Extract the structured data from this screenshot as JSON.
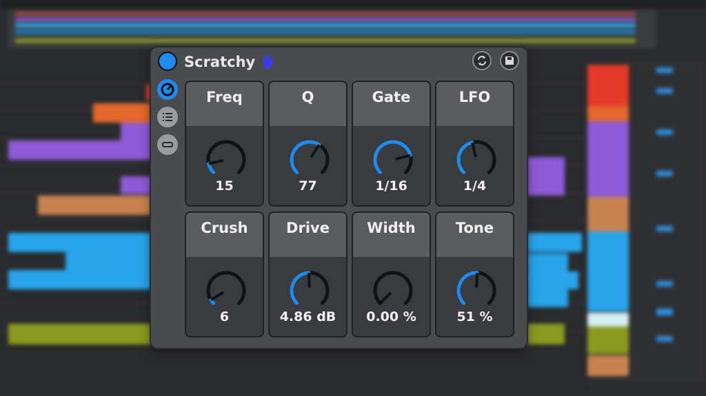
{
  "device": {
    "title": "Scratchy",
    "power_color": "#1d8bf0",
    "accent": "#1d8bf0"
  },
  "knobs": [
    {
      "name": "Freq",
      "value": "15",
      "fraction": 0.12
    },
    {
      "name": "Q",
      "value": "77",
      "fraction": 0.62
    },
    {
      "name": "Gate",
      "value": "1/16",
      "fraction": 0.78
    },
    {
      "name": "LFO",
      "value": "1/4",
      "fraction": 0.45
    },
    {
      "name": "Crush",
      "value": "6",
      "fraction": 0.05
    },
    {
      "name": "Drive",
      "value": "4.86 dB",
      "fraction": 0.49
    },
    {
      "name": "Width",
      "value": "0.00 %",
      "fraction": 0.0
    },
    {
      "name": "Tone",
      "value": "51 %",
      "fraction": 0.51
    }
  ],
  "header_buttons": [
    "refresh-icon",
    "save-icon"
  ],
  "side_buttons": [
    "mod-icon",
    "list-icon",
    "minimize-icon"
  ],
  "colors": {
    "knob_track": "#111214",
    "knob_fill": "#1d8bf0",
    "bg": "#2a2b2d"
  }
}
